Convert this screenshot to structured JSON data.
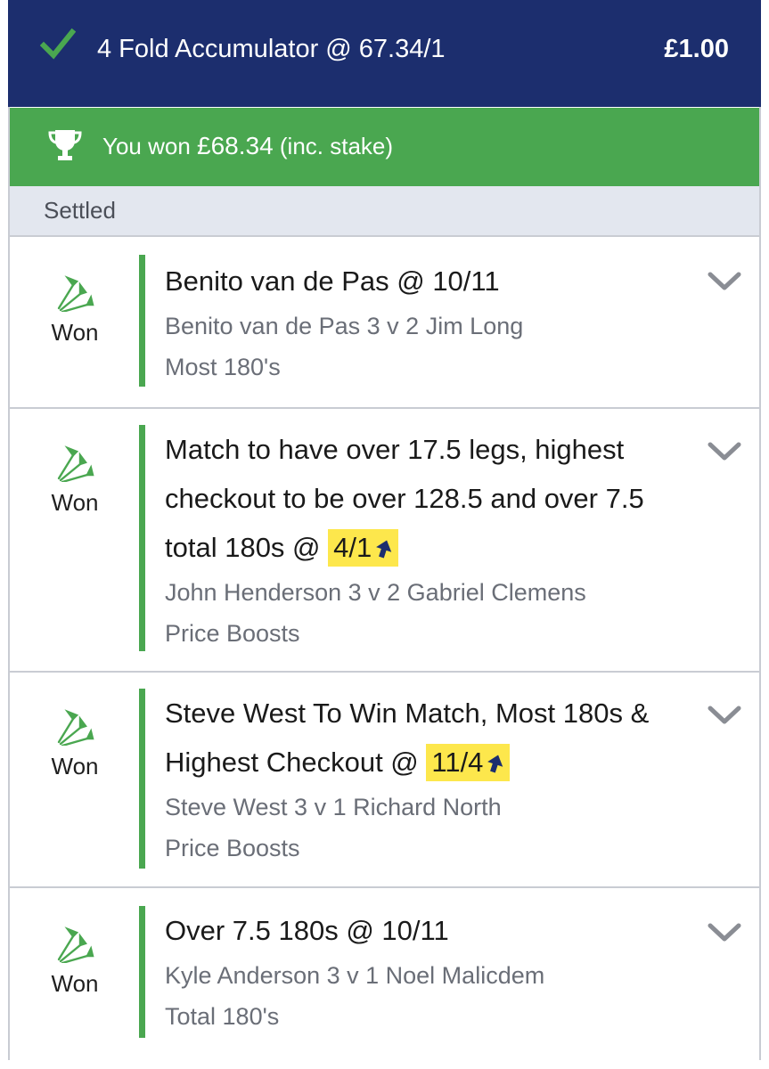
{
  "header": {
    "icon": "check-icon",
    "title": "4 Fold Accumulator @ 67.34/1",
    "stake": "£1.00",
    "bg_color": "#1c2e6e"
  },
  "result_banner": {
    "icon": "trophy-icon",
    "prefix": "You won ",
    "amount": "£68.34",
    "suffix": " (inc. stake)",
    "bg_color": "#4aa750"
  },
  "status": {
    "label": "Settled"
  },
  "legs": [
    {
      "result": "Won",
      "selection": "Benito van de Pas @ 10/11",
      "match": "Benito van de Pas 3 v 2 Jim Long",
      "market": "Most 180's"
    },
    {
      "result": "Won",
      "selection_text": "Match to have over 17.5 legs, highest checkout to be over 128.5 and over 7.5 total 180s @ ",
      "boosted_price": "4/1",
      "match": "John Henderson 3 v 2 Gabriel Clemens",
      "market": "Price Boosts"
    },
    {
      "result": "Won",
      "selection_text": "Steve West To Win Match, Most 180s & Highest Checkout @ ",
      "boosted_price": "11/4",
      "match": "Steve West 3 v 1 Richard North",
      "market": "Price Boosts"
    },
    {
      "result": "Won",
      "selection": "Over 7.5 180s @ 10/11",
      "match": "Kyle Anderson 3 v 1 Noel Malicdem",
      "market": "Total 180's"
    }
  ],
  "icons": {
    "result": "darts-icon",
    "expand": "chevron-down-icon",
    "boost": "boost-arrow-icon"
  },
  "colors": {
    "win_green": "#4aa750",
    "boost_highlight": "#fde74c",
    "navy": "#1c2e6e"
  }
}
